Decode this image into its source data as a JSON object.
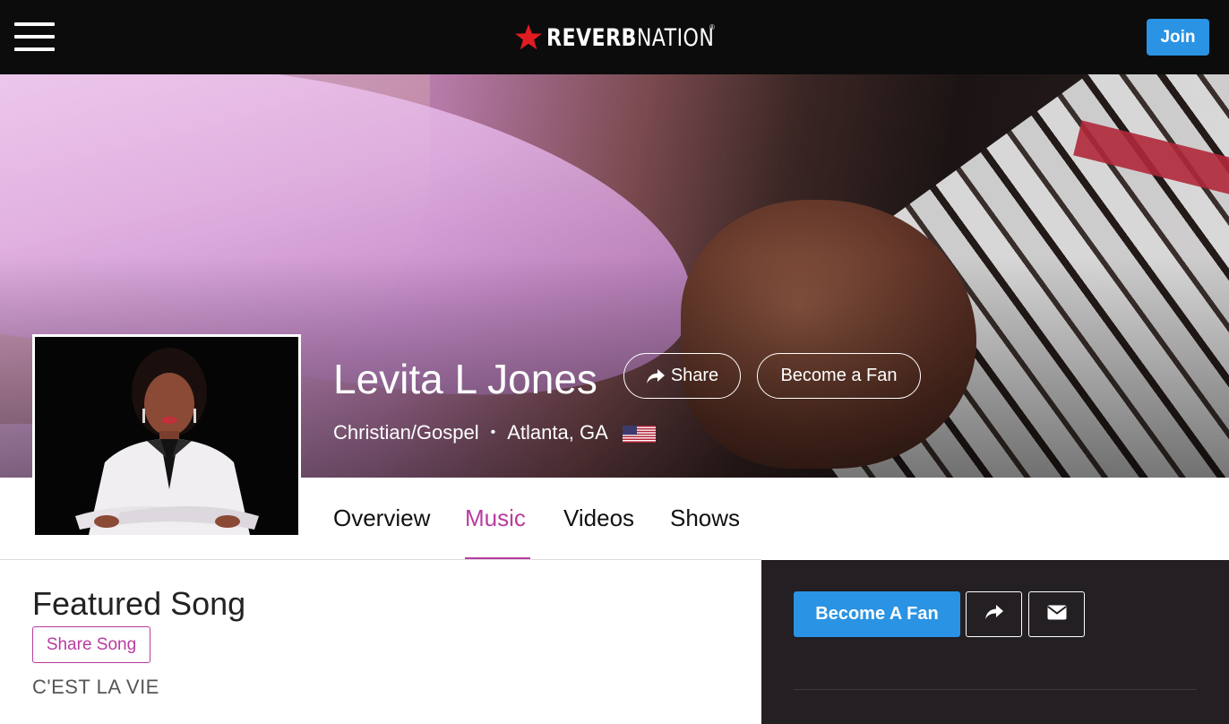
{
  "header": {
    "logo_text_bold": "REVERB",
    "logo_text_thin": "NATION",
    "logo_registered": "®",
    "join_label": "Join",
    "menu_icon": "hamburger-menu-icon",
    "logo_icon": "red-star-icon"
  },
  "artist": {
    "name": "Levita L Jones",
    "genre": "Christian/Gospel",
    "separator": "•",
    "location": "Atlanta, GA",
    "country_flag": "us-flag-icon",
    "share_label": "Share",
    "become_fan_label": "Become a Fan"
  },
  "tabs": [
    {
      "label": "Overview",
      "active": false
    },
    {
      "label": "Music",
      "active": true
    },
    {
      "label": "Videos",
      "active": false
    },
    {
      "label": "Shows",
      "active": false
    }
  ],
  "featured": {
    "heading": "Featured Song",
    "share_song_label": "Share Song",
    "song_title": "C'EST LA VIE"
  },
  "sidebar": {
    "become_fan_label": "Become A Fan",
    "share_icon": "share-arrow-icon",
    "mail_icon": "envelope-icon"
  },
  "colors": {
    "accent_blue": "#2a93e3",
    "accent_magenta": "#b83c9f",
    "topbar": "#0c0c0c",
    "dark_panel": "#231f23",
    "logo_star": "#e21b23"
  }
}
